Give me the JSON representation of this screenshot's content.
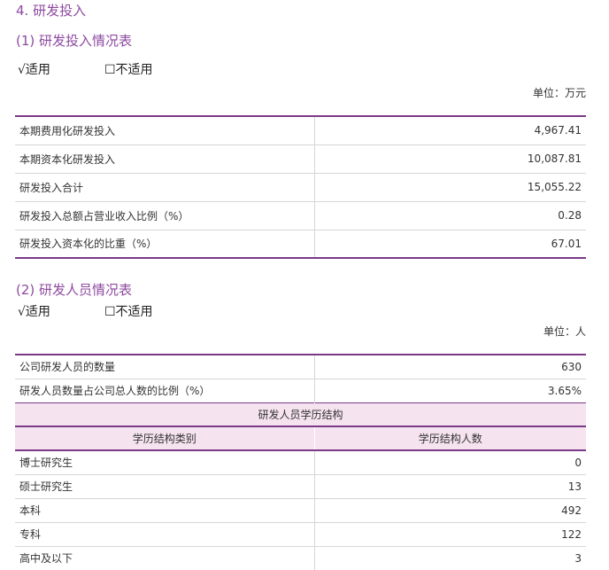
{
  "section": {
    "title": "4. 研发投入"
  },
  "rd_input": {
    "title": "(1) 研发投入情况表",
    "applicable": "√适用",
    "not_applicable": "☐不适用",
    "unit": "单位：万元",
    "rows": [
      {
        "label": "本期费用化研发投入",
        "value": "4,967.41"
      },
      {
        "label": "本期资本化研发投入",
        "value": "10,087.81"
      },
      {
        "label": "研发投入合计",
        "value": "15,055.22"
      },
      {
        "label": "研发投入总额占营业收入比例（%）",
        "value": "0.28"
      },
      {
        "label": "研发投入资本化的比重（%）",
        "value": "67.01"
      }
    ]
  },
  "rd_staff": {
    "title": "(2) 研发人员情况表",
    "applicable": "√适用",
    "not_applicable": "☐不适用",
    "unit": "单位：人",
    "rows": [
      {
        "label": "公司研发人员的数量",
        "value": "630"
      },
      {
        "label": "研发人员数量占公司总人数的比例（%）",
        "value": "3.65%"
      }
    ],
    "education": {
      "title": "研发人员学历结构",
      "col_category": "学历结构类别",
      "col_count": "学历结构人数",
      "rows": [
        {
          "label": "博士研究生",
          "value": "0"
        },
        {
          "label": "硕士研究生",
          "value": "13"
        },
        {
          "label": "本科",
          "value": "492"
        },
        {
          "label": "专科",
          "value": "122"
        },
        {
          "label": "高中及以下",
          "value": "3"
        }
      ]
    }
  }
}
